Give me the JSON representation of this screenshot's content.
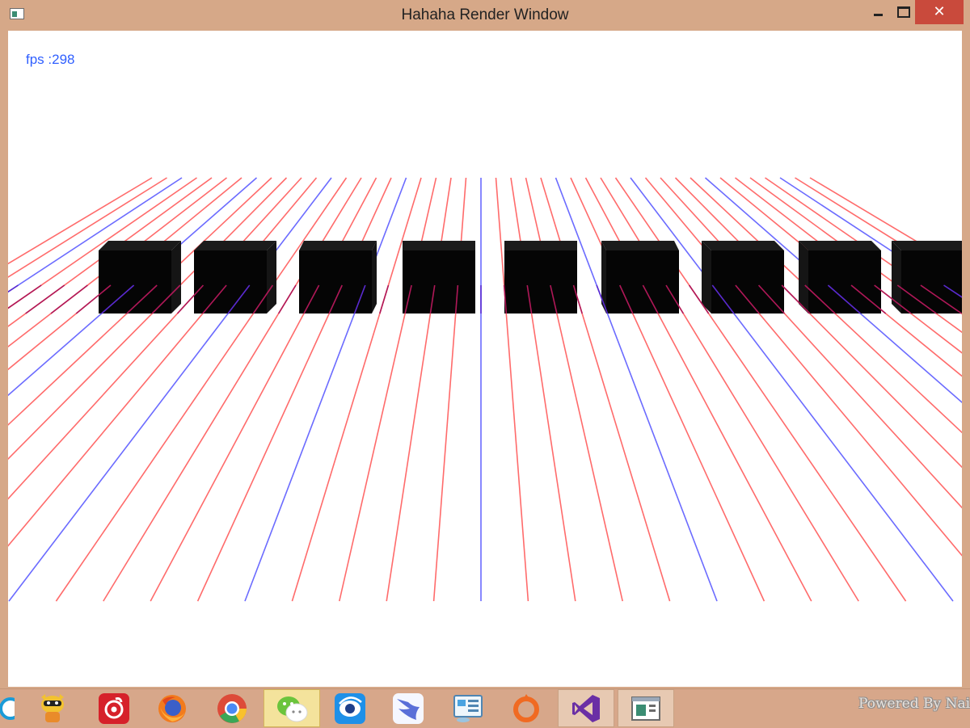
{
  "window": {
    "title": "Hahaha Render Window",
    "close_glyph": "✕"
  },
  "overlay": {
    "fps_text": "fps :298"
  },
  "colors": {
    "red_grid_line": "#ff6b6b",
    "blue_grid_line": "#6b6bff",
    "cube_fill": "#050505",
    "fps_text": "#2f5fff",
    "titlebar": "#d6a888",
    "close_button": "#c94a3c"
  },
  "taskbar": {
    "items": [
      {
        "icon": "browser-partial-icon"
      },
      {
        "icon": "raccoon-mascot-icon"
      },
      {
        "icon": "netease-music-icon"
      },
      {
        "icon": "firefox-icon"
      },
      {
        "icon": "chrome-icon"
      },
      {
        "icon": "wechat-icon",
        "state": "active"
      },
      {
        "icon": "eye-app-icon"
      },
      {
        "icon": "swift-bird-icon"
      },
      {
        "icon": "control-panel-icon"
      },
      {
        "icon": "origin-icon"
      },
      {
        "icon": "visual-studio-icon",
        "state": "open"
      },
      {
        "icon": "render-window-icon",
        "state": "open"
      }
    ],
    "watermark": "Powered By NaiSaD"
  }
}
